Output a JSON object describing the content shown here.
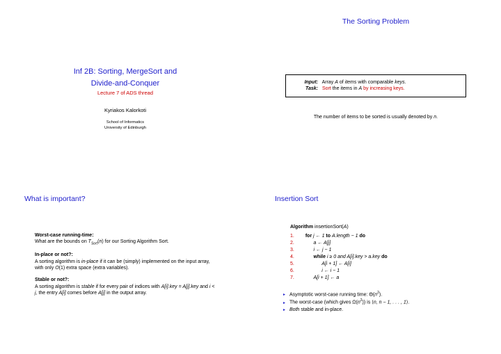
{
  "slide1": {
    "title_l1": "Inf 2B: Sorting, MergeSort and",
    "title_l2": "Divide-and-Conquer",
    "subtitle": "Lecture 7 of ADS thread",
    "author": "Kyriakos Kalorkoti",
    "affil_l1": "School of Informatics",
    "affil_l2": "University of Edinburgh"
  },
  "slide2": {
    "heading": "The Sorting Problem",
    "input_label": "Input:",
    "input_text_a": "Array ",
    "input_text_b": " of ",
    "input_text_c": " with comparable ",
    "input_text_d": ".",
    "input_A": "A",
    "input_items": "items",
    "input_keys": "keys",
    "task_label": "Task:",
    "task_red1": "Sort",
    "task_mid": " the items in ",
    "task_A": "A",
    "task_red2": " by increasing keys.",
    "bottom_a": "The number of items to be sorted is usually denoted by ",
    "bottom_n": "n",
    "bottom_c": "."
  },
  "slide3": {
    "heading": "What is important?",
    "t1_head": "Worst-case running-time:",
    "t1_a": "What are the bounds on ",
    "t1_T": "T",
    "t1_sub": "Sort",
    "t1_b": "(",
    "t1_n": "n",
    "t1_c": ") for our Sorting Algorithm Sort.",
    "t2_head": "In-place or not?:",
    "t2_a": "A sorting algorithm is ",
    "t2_ip": "in-place",
    "t2_b": " if it can be (simply) implemented on the input array, with only ",
    "t2_O": "O",
    "t2_c": "(1) extra space (extra variables).",
    "t3_head": "Stable or not?:",
    "t3_a": "A sorting algorithm is ",
    "t3_st": "stable",
    "t3_b": " if for every pair of indices with ",
    "t3_expr": "A[i].key = A[j].key",
    "t3_c": " and ",
    "t3_ij": "i < j",
    "t3_d": ", the entry ",
    "t3_Ai": "A[i]",
    "t3_e": " comes before ",
    "t3_Aj": "A[j]",
    "t3_f": " in the output array."
  },
  "slide4": {
    "heading": "Insertion Sort",
    "algo_label": "Algorithm",
    "algo_name": " insertionSort(",
    "algo_A": "A",
    "algo_close": ")",
    "lines": {
      "n1": "1.",
      "l1a": "for ",
      "l1b": "j ← 1 ",
      "l1c": "to ",
      "l1d": "A.length − 1 ",
      "l1e": "do",
      "n2": "2.",
      "l2": "a ← A[j]",
      "n3": "3.",
      "l3": "i ← j − 1",
      "n4": "4.",
      "l4a": "while ",
      "l4b": "i ≥ 0 and A[i].key > a.key ",
      "l4c": "do",
      "n5": "5.",
      "l5": "A[i + 1] ← A[i]",
      "n6": "6.",
      "l6": "i ← i − 1",
      "n7": "7.",
      "l7": "A[i + 1] ← a"
    },
    "b1_a": "Asymptotic worst-case running time: Θ(",
    "b1_n": "n",
    "b1_sup": "2",
    "b1_b": ").",
    "b2_a": "The worst-case (which gives Ω(",
    "b2_n": "n",
    "b2_sup": "2",
    "b2_b": ")) is ⟨",
    "b2_seq": "n, n − 1, . . . , 1",
    "b2_c": "⟩.",
    "b3_a": "Both",
    "b3_b": " stable and in-place."
  }
}
